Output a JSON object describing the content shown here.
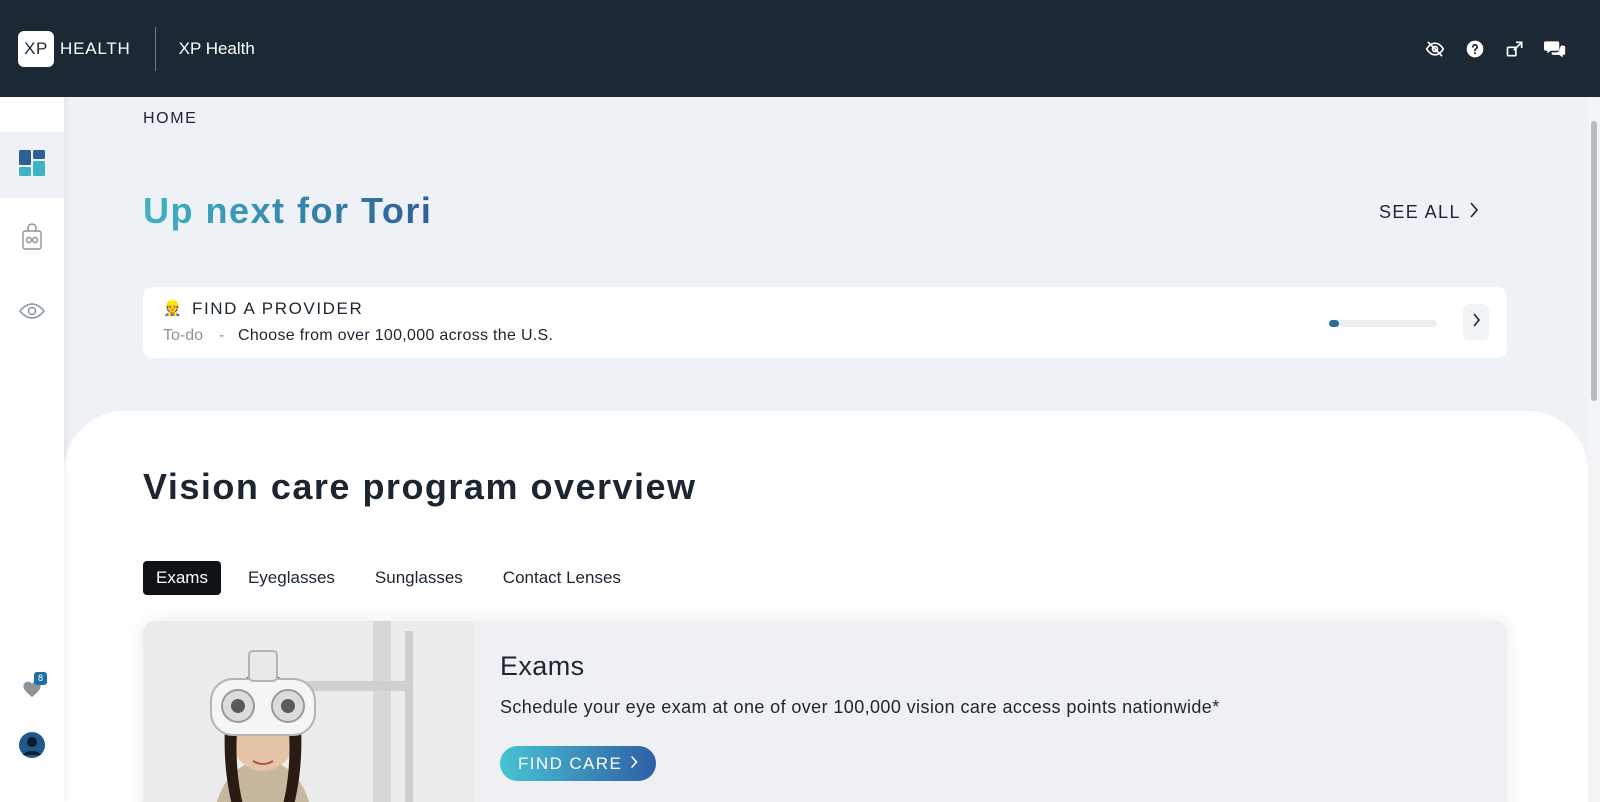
{
  "header": {
    "logo_box": "XP",
    "logo_word": "HEALTH",
    "app_title": "XP Health",
    "icons": [
      "eye-off-icon",
      "help-icon",
      "external-link-icon",
      "chat-icon"
    ]
  },
  "sidebar": {
    "items": [
      {
        "icon": "dashboard-icon",
        "active": true
      },
      {
        "icon": "eyeglasses-bag-icon",
        "active": false
      },
      {
        "icon": "eye-icon",
        "active": false
      }
    ],
    "favorites_count": "8",
    "bottom_icons": [
      "heart-icon",
      "avatar"
    ]
  },
  "main": {
    "breadcrumb": "HOME",
    "up_next_title": "Up next for Tori",
    "see_all_label": "SEE ALL",
    "todo": {
      "emoji": "👷",
      "title": "FIND A PROVIDER",
      "status": "To-do",
      "separator": "-",
      "description": "Choose from over 100,000 across the U.S.",
      "progress": 0.05
    }
  },
  "overview": {
    "title": "Vision care program overview",
    "tabs": [
      {
        "label": "Exams",
        "active": true
      },
      {
        "label": "Eyeglasses",
        "active": false
      },
      {
        "label": "Sunglasses",
        "active": false
      },
      {
        "label": "Contact Lenses",
        "active": false
      }
    ],
    "card": {
      "title": "Exams",
      "description": "Schedule your eye exam at one of over 100,000 vision care access points nationwide*",
      "button_label": "FIND CARE"
    }
  },
  "colors": {
    "topbar": "#1c2833",
    "accent_start": "#48c3d3",
    "accent_end": "#2f5fa6",
    "progress": "#2b6c9a"
  }
}
